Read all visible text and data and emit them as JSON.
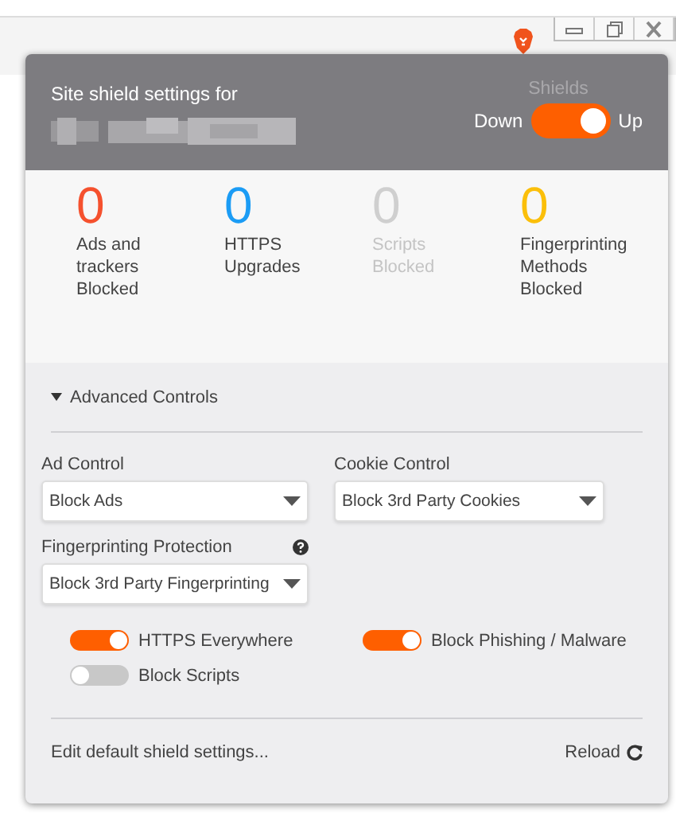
{
  "header": {
    "title": "Site shield settings for",
    "shields_label": "Shields",
    "toggle": {
      "off_label": "Down",
      "on_label": "Up",
      "on": true
    }
  },
  "stats": [
    {
      "count": "0",
      "label": "Ads and trackers Blocked",
      "color": "#f5512e",
      "disabled": false
    },
    {
      "count": "0",
      "label": "HTTPS Upgrades",
      "color": "#1b9cf5",
      "disabled": false
    },
    {
      "count": "0",
      "label": "Scripts Blocked",
      "color": "#cfcfcf",
      "disabled": true
    },
    {
      "count": "0",
      "label": "Fingerprinting Methods Blocked",
      "color": "#fbbf0a",
      "disabled": false
    }
  ],
  "advanced": {
    "label": "Advanced Controls",
    "expanded": true
  },
  "selects": [
    {
      "label": "Ad Control",
      "value": "Block Ads",
      "help": false
    },
    {
      "label": "Cookie Control",
      "value": "Block 3rd Party Cookies",
      "help": false
    },
    {
      "label": "Fingerprinting Protection",
      "value": "Block 3rd Party Fingerprinting",
      "help": true
    }
  ],
  "switches": [
    {
      "label": "HTTPS Everywhere",
      "on": true
    },
    {
      "label": "Block Phishing / Malware",
      "on": true
    },
    {
      "label": "Block Scripts",
      "on": false
    }
  ],
  "footer": {
    "edit_link": "Edit default shield settings...",
    "reload": "Reload"
  }
}
